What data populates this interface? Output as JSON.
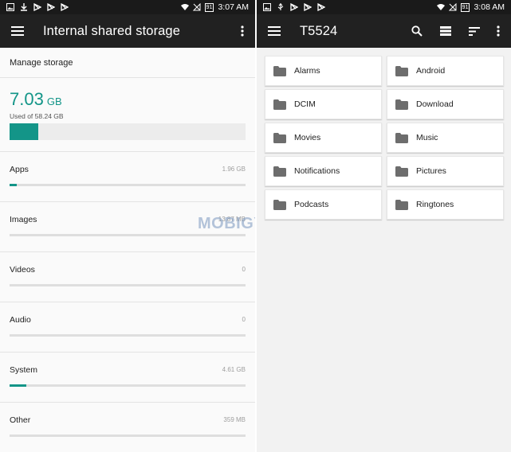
{
  "colors": {
    "accent": "#139588",
    "appbar": "#212121",
    "statusbar": "#1a1a1a"
  },
  "left": {
    "status": {
      "time": "3:07 AM",
      "sim_label": "91"
    },
    "appbar": {
      "title": "Internal shared storage",
      "menu_icon": "menu-icon",
      "overflow_icon": "more-vert-icon"
    },
    "manage_label": "Manage storage",
    "summary": {
      "used_value": "7.03",
      "used_unit": "GB",
      "used_caption": "Used of 58.24 GB",
      "used_fraction": 0.121
    },
    "categories": [
      {
        "label": "Apps",
        "size": "1.96 GB",
        "fraction": 0.03
      },
      {
        "label": "Images",
        "size": "13.87 MB",
        "fraction": 0.0
      },
      {
        "label": "Videos",
        "size": "0",
        "fraction": 0.0
      },
      {
        "label": "Audio",
        "size": "0",
        "fraction": 0.0
      },
      {
        "label": "System",
        "size": "4.61 GB",
        "fraction": 0.072
      },
      {
        "label": "Other",
        "size": "359 MB",
        "fraction": 0.0
      }
    ],
    "watermark": "MOBIGYAAN"
  },
  "right": {
    "status": {
      "time": "3:08 AM",
      "sim_label": "91"
    },
    "appbar": {
      "title": "T5524",
      "icons": [
        "search-icon",
        "list-view-icon",
        "sort-icon",
        "more-vert-icon"
      ]
    },
    "folders": [
      "Alarms",
      "Android",
      "DCIM",
      "Download",
      "Movies",
      "Music",
      "Notifications",
      "Pictures",
      "Podcasts",
      "Ringtones"
    ]
  }
}
